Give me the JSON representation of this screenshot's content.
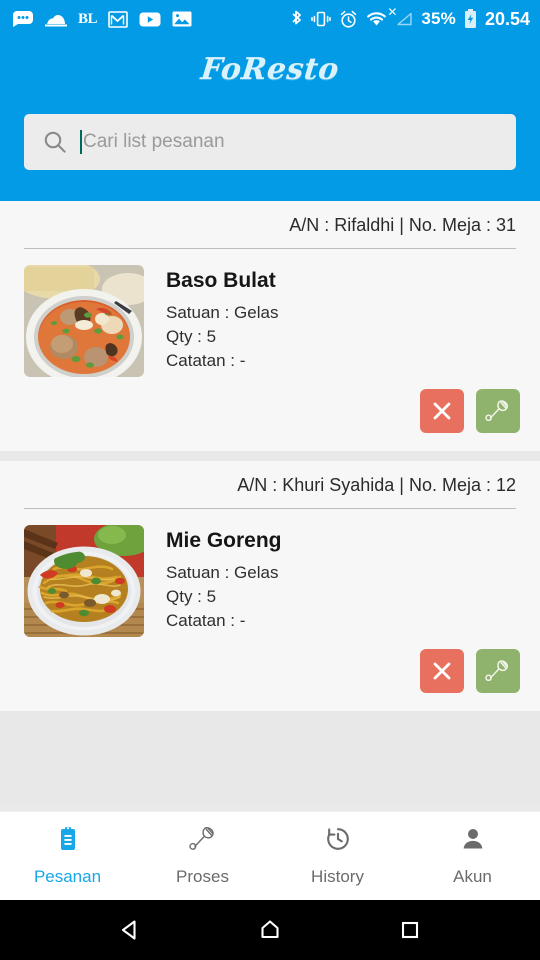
{
  "statusbar": {
    "left_icons": [
      "messages-icon",
      "cloud-app-icon",
      "bl-app-icon",
      "gmail-icon",
      "youtube-icon",
      "gallery-icon"
    ],
    "bl_label": "BL",
    "right_icons": [
      "bluetooth-icon",
      "vibrate-icon",
      "alarm-icon",
      "wifi-icon",
      "no-signal-icon",
      "battery-charging-icon"
    ],
    "battery_percent": "35%",
    "time": "20.54"
  },
  "appbar": {
    "logo": "FoResto"
  },
  "search": {
    "placeholder": "Cari list pesanan",
    "value": ""
  },
  "orders": [
    {
      "customer_line": "A/N : Rifaldhi | No. Meja : 31",
      "dish": "Baso Bulat",
      "satuan": "Satuan : Gelas",
      "qty": "Qty : 5",
      "catatan": "Catatan : -",
      "thumb": "bakso-soup-photo",
      "cancel_icon": "close-icon",
      "cook_icon": "spatula-icon"
    },
    {
      "customer_line": "A/N : Khuri Syahida | No. Meja : 12",
      "dish": "Mie Goreng",
      "satuan": "Satuan : Gelas",
      "qty": "Qty : 5",
      "catatan": "Catatan : -",
      "thumb": "fried-noodles-photo",
      "cancel_icon": "close-icon",
      "cook_icon": "spatula-icon"
    }
  ],
  "bottomnav": {
    "items": [
      {
        "label": "Pesanan",
        "icon": "clipboard-icon",
        "active": true
      },
      {
        "label": "Proses",
        "icon": "spatula-icon",
        "active": false
      },
      {
        "label": "History",
        "icon": "history-clock-icon",
        "active": false
      },
      {
        "label": "Akun",
        "icon": "person-icon",
        "active": false
      }
    ]
  },
  "androidnav": {
    "back": "back-triangle-icon",
    "home": "home-pentagon-icon",
    "recents": "recents-square-icon"
  },
  "colors": {
    "primary": "#039be5",
    "accent": "#17a7e8",
    "cancel": "#e8705f",
    "cook": "#8fb26c",
    "page_bg": "#eaeaea",
    "card_bg": "#f7f7f7"
  }
}
